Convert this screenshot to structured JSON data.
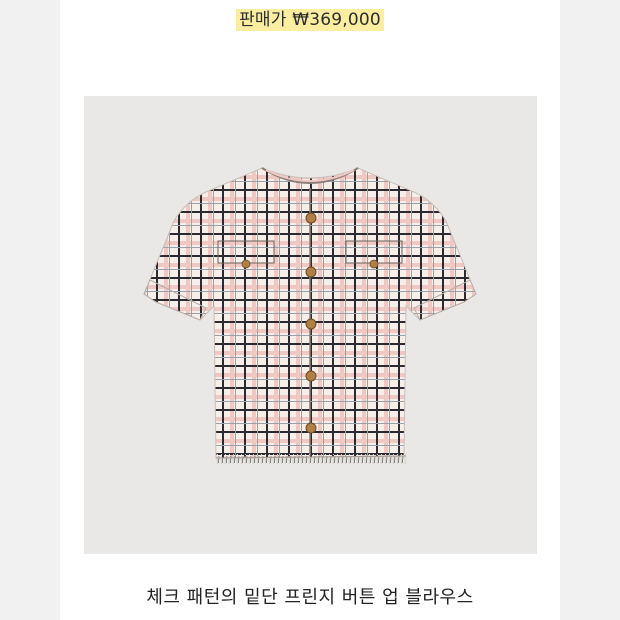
{
  "price_label": "판매가 ₩369,000",
  "product_title": "체크 패턴의 밑단 프린지 버튼 업 블라우스",
  "colors": {
    "page_bg": "#f1f1f1",
    "card_bg": "#ffffff",
    "price_highlight": "#fbeea0",
    "photo_bg": "#e9e8e6",
    "fabric_base": "#f6efe9",
    "check_dark": "#2b2a30",
    "check_pink": "#e9b2ae",
    "button_gold": "#b07f46"
  },
  "image": {
    "subject": "tweed-check-jacket",
    "button_count": 5
  }
}
